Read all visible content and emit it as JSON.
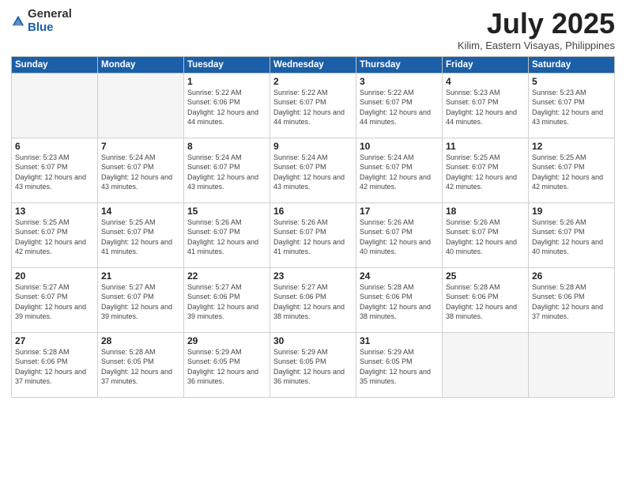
{
  "logo": {
    "general": "General",
    "blue": "Blue"
  },
  "header": {
    "month": "July 2025",
    "location": "Kilim, Eastern Visayas, Philippines"
  },
  "weekdays": [
    "Sunday",
    "Monday",
    "Tuesday",
    "Wednesday",
    "Thursday",
    "Friday",
    "Saturday"
  ],
  "weeks": [
    [
      {
        "day": "",
        "empty": true
      },
      {
        "day": "",
        "empty": true
      },
      {
        "day": "1",
        "sunrise": "5:22 AM",
        "sunset": "6:06 PM",
        "daylight": "12 hours and 44 minutes."
      },
      {
        "day": "2",
        "sunrise": "5:22 AM",
        "sunset": "6:07 PM",
        "daylight": "12 hours and 44 minutes."
      },
      {
        "day": "3",
        "sunrise": "5:22 AM",
        "sunset": "6:07 PM",
        "daylight": "12 hours and 44 minutes."
      },
      {
        "day": "4",
        "sunrise": "5:23 AM",
        "sunset": "6:07 PM",
        "daylight": "12 hours and 44 minutes."
      },
      {
        "day": "5",
        "sunrise": "5:23 AM",
        "sunset": "6:07 PM",
        "daylight": "12 hours and 43 minutes."
      }
    ],
    [
      {
        "day": "6",
        "sunrise": "5:23 AM",
        "sunset": "6:07 PM",
        "daylight": "12 hours and 43 minutes."
      },
      {
        "day": "7",
        "sunrise": "5:24 AM",
        "sunset": "6:07 PM",
        "daylight": "12 hours and 43 minutes."
      },
      {
        "day": "8",
        "sunrise": "5:24 AM",
        "sunset": "6:07 PM",
        "daylight": "12 hours and 43 minutes."
      },
      {
        "day": "9",
        "sunrise": "5:24 AM",
        "sunset": "6:07 PM",
        "daylight": "12 hours and 43 minutes."
      },
      {
        "day": "10",
        "sunrise": "5:24 AM",
        "sunset": "6:07 PM",
        "daylight": "12 hours and 42 minutes."
      },
      {
        "day": "11",
        "sunrise": "5:25 AM",
        "sunset": "6:07 PM",
        "daylight": "12 hours and 42 minutes."
      },
      {
        "day": "12",
        "sunrise": "5:25 AM",
        "sunset": "6:07 PM",
        "daylight": "12 hours and 42 minutes."
      }
    ],
    [
      {
        "day": "13",
        "sunrise": "5:25 AM",
        "sunset": "6:07 PM",
        "daylight": "12 hours and 42 minutes."
      },
      {
        "day": "14",
        "sunrise": "5:25 AM",
        "sunset": "6:07 PM",
        "daylight": "12 hours and 41 minutes."
      },
      {
        "day": "15",
        "sunrise": "5:26 AM",
        "sunset": "6:07 PM",
        "daylight": "12 hours and 41 minutes."
      },
      {
        "day": "16",
        "sunrise": "5:26 AM",
        "sunset": "6:07 PM",
        "daylight": "12 hours and 41 minutes."
      },
      {
        "day": "17",
        "sunrise": "5:26 AM",
        "sunset": "6:07 PM",
        "daylight": "12 hours and 40 minutes."
      },
      {
        "day": "18",
        "sunrise": "5:26 AM",
        "sunset": "6:07 PM",
        "daylight": "12 hours and 40 minutes."
      },
      {
        "day": "19",
        "sunrise": "5:26 AM",
        "sunset": "6:07 PM",
        "daylight": "12 hours and 40 minutes."
      }
    ],
    [
      {
        "day": "20",
        "sunrise": "5:27 AM",
        "sunset": "6:07 PM",
        "daylight": "12 hours and 39 minutes."
      },
      {
        "day": "21",
        "sunrise": "5:27 AM",
        "sunset": "6:07 PM",
        "daylight": "12 hours and 39 minutes."
      },
      {
        "day": "22",
        "sunrise": "5:27 AM",
        "sunset": "6:06 PM",
        "daylight": "12 hours and 39 minutes."
      },
      {
        "day": "23",
        "sunrise": "5:27 AM",
        "sunset": "6:06 PM",
        "daylight": "12 hours and 38 minutes."
      },
      {
        "day": "24",
        "sunrise": "5:28 AM",
        "sunset": "6:06 PM",
        "daylight": "12 hours and 38 minutes."
      },
      {
        "day": "25",
        "sunrise": "5:28 AM",
        "sunset": "6:06 PM",
        "daylight": "12 hours and 38 minutes."
      },
      {
        "day": "26",
        "sunrise": "5:28 AM",
        "sunset": "6:06 PM",
        "daylight": "12 hours and 37 minutes."
      }
    ],
    [
      {
        "day": "27",
        "sunrise": "5:28 AM",
        "sunset": "6:06 PM",
        "daylight": "12 hours and 37 minutes."
      },
      {
        "day": "28",
        "sunrise": "5:28 AM",
        "sunset": "6:05 PM",
        "daylight": "12 hours and 37 minutes."
      },
      {
        "day": "29",
        "sunrise": "5:29 AM",
        "sunset": "6:05 PM",
        "daylight": "12 hours and 36 minutes."
      },
      {
        "day": "30",
        "sunrise": "5:29 AM",
        "sunset": "6:05 PM",
        "daylight": "12 hours and 36 minutes."
      },
      {
        "day": "31",
        "sunrise": "5:29 AM",
        "sunset": "6:05 PM",
        "daylight": "12 hours and 35 minutes."
      },
      {
        "day": "",
        "empty": true
      },
      {
        "day": "",
        "empty": true
      }
    ]
  ]
}
